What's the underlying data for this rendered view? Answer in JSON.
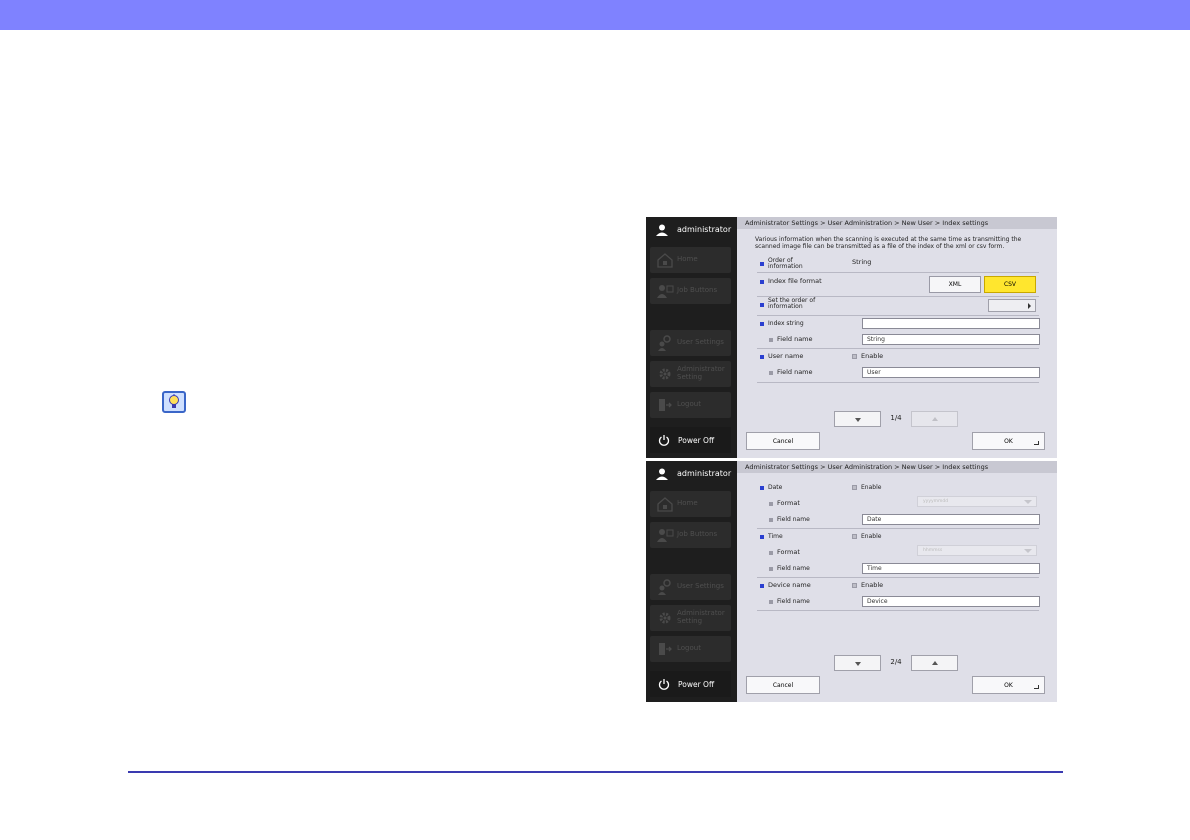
{
  "colors": {
    "top_bar": "#7f82ff",
    "bottom_rule": "#3a3ab0",
    "csv_selected": "#ffe62e"
  },
  "icons": {
    "hint": "lightbulb-icon",
    "user": "user-icon",
    "power": "power-icon"
  },
  "sidebar": {
    "user": "administrator",
    "items": [
      {
        "label": "Home",
        "icon": "home-icon"
      },
      {
        "label": "Job Buttons",
        "icon": "job-buttons-icon"
      },
      {
        "label": "User Settings",
        "icon": "user-settings-icon"
      },
      {
        "label": "Administrator Setting",
        "icon": "gear-icon"
      },
      {
        "label": "Logout",
        "icon": "logout-icon"
      }
    ],
    "power_off": "Power Off"
  },
  "screen1": {
    "breadcrumb": "Administrator Settings > User Administration > New User > Index settings",
    "description": "Various information when the scanning is executed at the same time as transmitting the scanned image file can be transmitted as a file of the index of the xml or csv form.",
    "order_label": "Order of information",
    "order_value": "String",
    "index_format_label": "Index file format",
    "xml_label": "XML",
    "csv_label": "CSV",
    "set_order_label": "Set the order of information",
    "index_string_label": "Index string",
    "index_string_value": "",
    "field_name_label": "Field name",
    "string_field_value": "String",
    "user_name_label": "User name",
    "enable_label": "Enable",
    "user_field_value": "User",
    "page": "1/4",
    "cancel": "Cancel",
    "ok": "OK"
  },
  "screen2": {
    "breadcrumb": "Administrator Settings > User Administration > New User > Index settings",
    "date_label": "Date",
    "enable_label": "Enable",
    "format_label": "Format",
    "date_format_value": "yyyymmdd",
    "field_name_label": "Field name",
    "date_field_value": "Date",
    "time_label": "Time",
    "time_format_value": "hhmmss",
    "time_field_value": "Time",
    "device_label": "Device name",
    "device_field_value": "Device",
    "page": "2/4",
    "cancel": "Cancel",
    "ok": "OK"
  }
}
